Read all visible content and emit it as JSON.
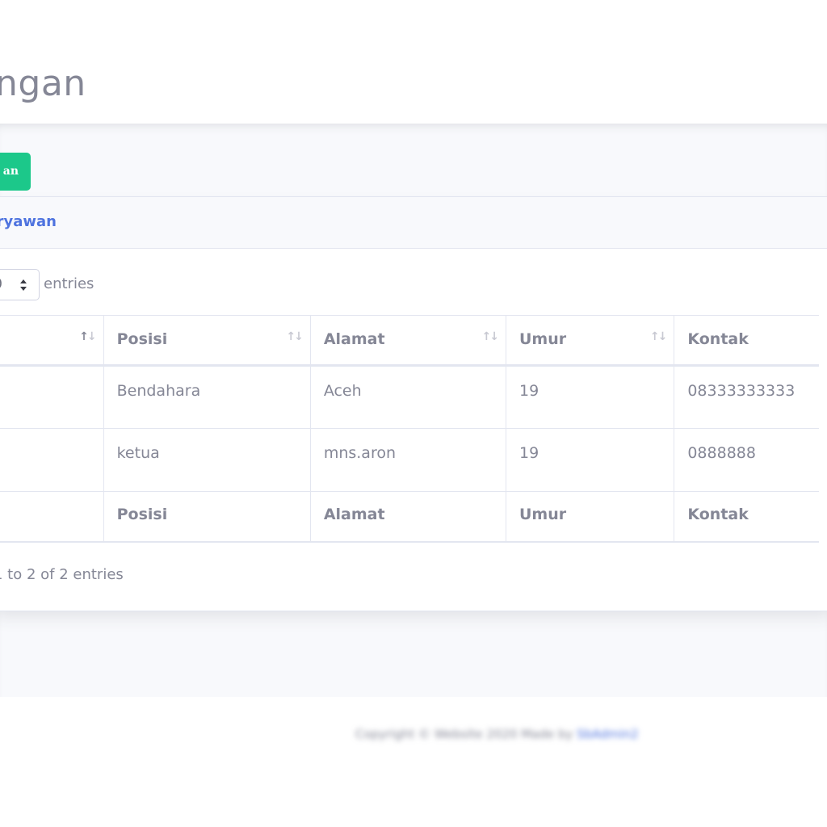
{
  "page": {
    "title": "ngan"
  },
  "toolbar": {
    "add_label": "an"
  },
  "card": {
    "title": "ryawan"
  },
  "length": {
    "value": "0",
    "suffix": "entries"
  },
  "table": {
    "headers": [
      "",
      "Posisi",
      "Alamat",
      "Umur",
      "Kontak"
    ],
    "rows": [
      [
        "",
        "Bendahara",
        "Aceh",
        "19",
        "08333333333"
      ],
      [
        "",
        "ketua",
        "mns.aron",
        "19",
        "0888888"
      ]
    ],
    "footer": [
      "",
      "Posisi",
      "Alamat",
      "Umur",
      "Kontak"
    ]
  },
  "info": {
    "text": "1 to 2 of 2 entries"
  },
  "footer": {
    "copyright": "Copyright © Website 2020 Made by",
    "link": "SbAdmin2"
  },
  "colors": {
    "accent": "#4e73df",
    "success": "#1cc88a",
    "text": "#858796",
    "border": "#e3e6f0",
    "content_bg": "#f8f9fc"
  },
  "icons": {
    "sort": "sort-arrows-icon",
    "select": "up-down-caret-icon"
  }
}
